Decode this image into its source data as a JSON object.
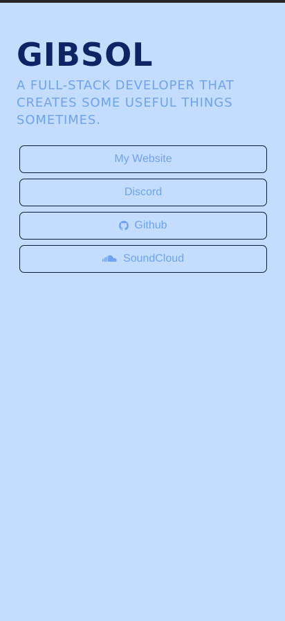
{
  "profile": {
    "name": "GIBSOL",
    "tagline": "A FULL-STACK DEVELOPER THAT CREATES SOME USEFUL THINGS SOMETIMES."
  },
  "links": [
    {
      "label": "My Website",
      "icon": null
    },
    {
      "label": "Discord",
      "icon": null
    },
    {
      "label": "Github",
      "icon": "github-icon"
    },
    {
      "label": "SoundCloud",
      "icon": "soundcloud-icon"
    }
  ],
  "colors": {
    "background": "#c4ddff",
    "title": "#0d2466",
    "accent": "#6ea2f2",
    "border": "#0b1b46",
    "top_bar": "#262626"
  }
}
